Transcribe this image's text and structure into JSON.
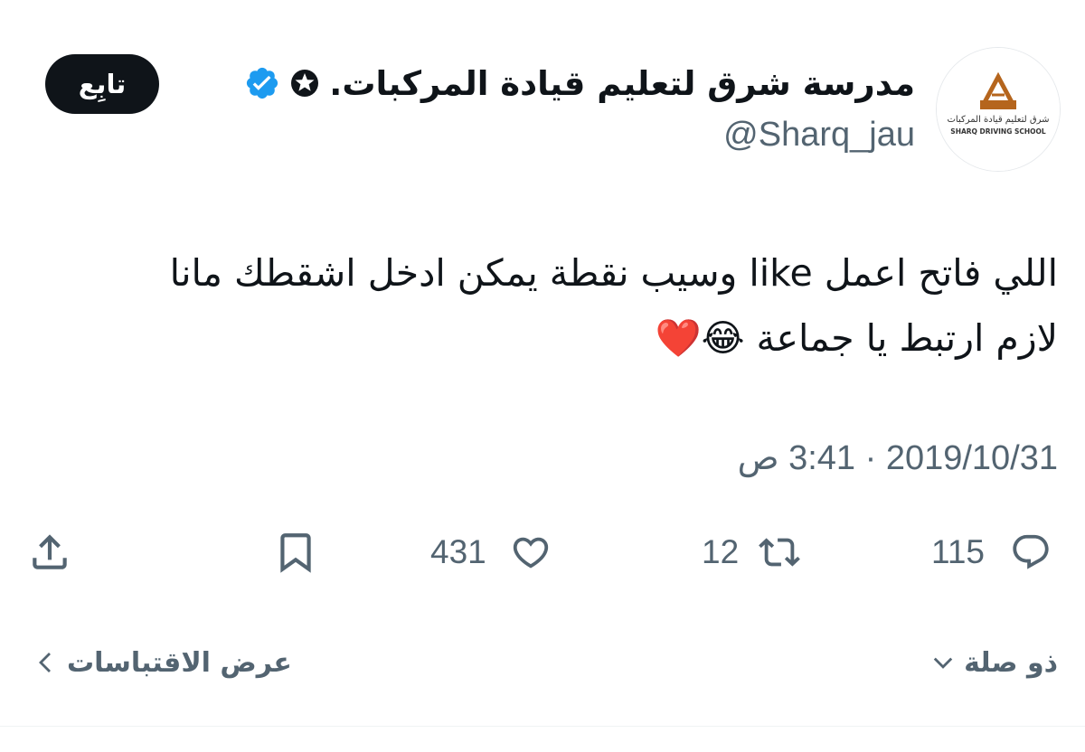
{
  "account": {
    "display_name": "مدرسة شرق لتعليم قيادة المركبات.",
    "handle": "@Sharq_jau",
    "avatar_brand_text": "شرق لتعليم قيادة المركبات",
    "avatar_brand_text_en": "SHARQ DRIVING SCHOOL",
    "verified_color": "#1d9bf0",
    "brand_color": "#b5651d"
  },
  "follow_button": {
    "label": "تابِع"
  },
  "tweet": {
    "text": "اللي فاتح اعمل like وسيب نقطة يمكن ادخل اشقطك مانا\nلازم ارتبط يا جماعة 😂❤️",
    "timestamp": "2019/10/31 · 3:41 ص"
  },
  "actions": {
    "replies": "115",
    "retweets": "12",
    "likes": "431",
    "icons": [
      "reply-icon",
      "retweet-icon",
      "like-icon",
      "bookmark-icon",
      "share-icon"
    ]
  },
  "footer": {
    "relevant_label": "ذو صلة",
    "quotes_label": "عرض الاقتباسات"
  }
}
